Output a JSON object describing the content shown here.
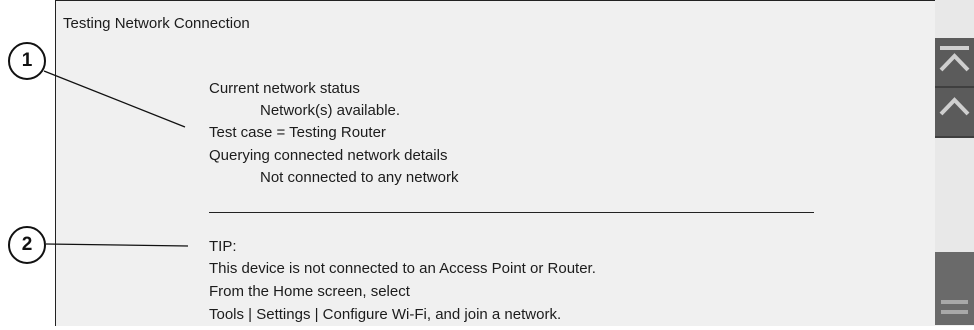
{
  "window": {
    "title": "Testing Network Connection"
  },
  "content": {
    "lines": [
      "Current network status",
      "Network(s) available.",
      "Test case = Testing Router",
      "Querying connected network details",
      "Not connected to any network"
    ],
    "tip": [
      "TIP:",
      "This device is not connected to an Access Point or Router.",
      "From the Home screen, select",
      "Tools | Settings | Configure Wi-Fi, and join a network."
    ]
  },
  "scrollbar": {
    "top_icon": "scroll-to-top-icon",
    "up_icon": "scroll-up-icon",
    "menu_icon": "menu-lines-icon"
  },
  "callouts": {
    "one": "1",
    "two": "2"
  },
  "colors": {
    "panel_bg": "#f0f0f0",
    "scroll_button": "#5b5b5b",
    "text": "#1c1c1c"
  }
}
